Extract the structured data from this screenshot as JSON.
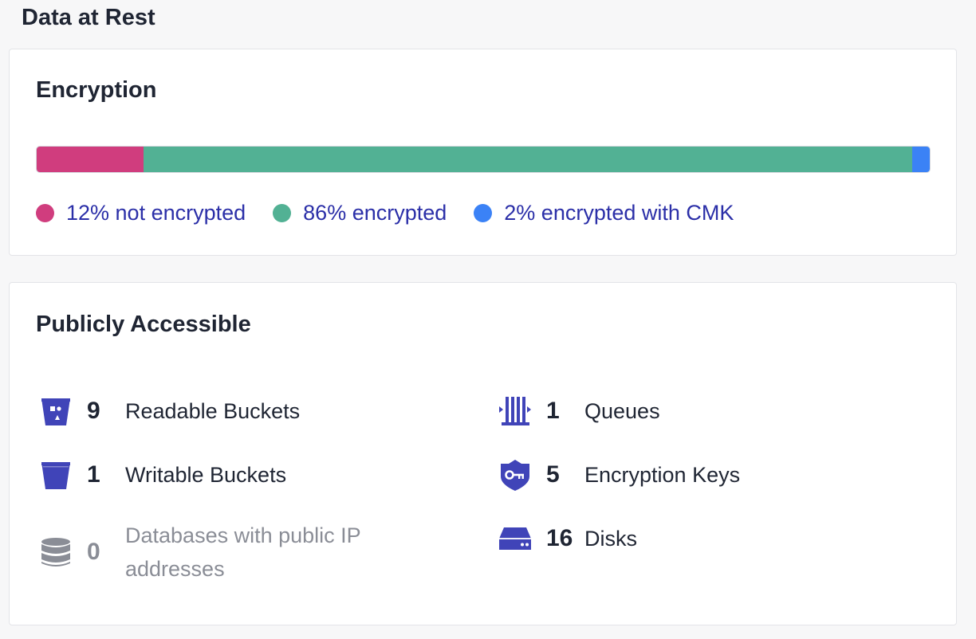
{
  "page": {
    "title": "Data at Rest"
  },
  "encryption": {
    "title": "Encryption",
    "segments": [
      {
        "label": "12% not encrypted",
        "percent": 12,
        "color": "#d03d7e"
      },
      {
        "label": "86% encrypted",
        "percent": 86,
        "color": "#52b194"
      },
      {
        "label": "2% encrypted with CMK",
        "percent": 2,
        "color": "#3b82f6"
      }
    ]
  },
  "public": {
    "title": "Publicly Accessible",
    "items": [
      {
        "icon": "bucket-readable-icon",
        "count": "9",
        "label": "Readable Buckets",
        "muted": false
      },
      {
        "icon": "bucket-icon",
        "count": "1",
        "label": "Writable Buckets",
        "muted": false
      },
      {
        "icon": "database-icon",
        "count": "0",
        "label": "Databases with public IP addresses",
        "muted": true
      },
      {
        "icon": "queue-icon",
        "count": "1",
        "label": "Queues",
        "muted": false
      },
      {
        "icon": "key-shield-icon",
        "count": "5",
        "label": "Encryption Keys",
        "muted": false
      },
      {
        "icon": "disk-icon",
        "count": "16",
        "label": "Disks",
        "muted": false
      }
    ]
  },
  "colors": {
    "icon": "#4044b8",
    "icon_muted": "#8a8d96",
    "legend_text": "#2b2fa8"
  }
}
